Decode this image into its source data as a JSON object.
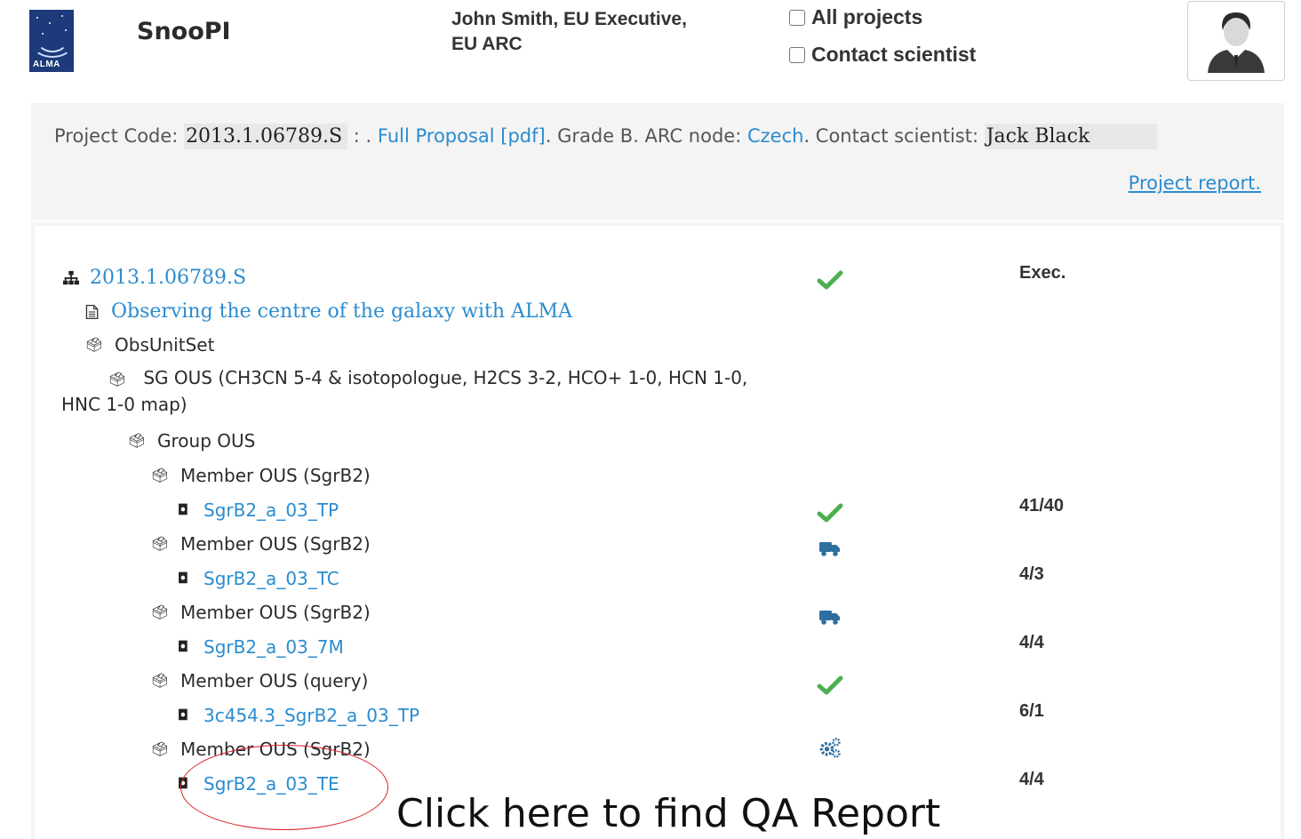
{
  "header": {
    "app_title": "SnooPI",
    "logo_text": "ALMA",
    "user_line1": "John Smith, EU Executive,",
    "user_line2": "EU ARC",
    "all_projects_label": "All projects",
    "contact_scientist_label": "Contact scientist"
  },
  "info": {
    "project_code_label": "Project Code:",
    "project_code": "2013.1.06789.S",
    "dot_sep": " : .",
    "full_proposal": "Full Proposal [pdf]",
    "grade_text": ". Grade B. ARC node:",
    "arc_node": "Czech",
    "contact_label": ". Contact scientist:",
    "contact_name": "Jack Black",
    "project_report": "Project report."
  },
  "tree": {
    "root": "2013.1.06789.S",
    "title": "Observing the centre of the galaxy with ALMA",
    "obs_unit_set": "ObsUnitSet",
    "sg_ous": "SG OUS (CH3CN 5-4 & isotopologue, H2CS 3-2, HCO+ 1-0, HCN 1-0, HNC 1-0 map)",
    "group_ous": "Group OUS",
    "root_status_text": "Exec.",
    "members": [
      {
        "member_label": "Member OUS (SgrB2)",
        "sb": "SgrB2_a_03_TP",
        "status": "check",
        "count": "41/40"
      },
      {
        "member_label": "Member OUS (SgrB2)",
        "sb": "SgrB2_a_03_TC",
        "status": "truck",
        "count": "4/3"
      },
      {
        "member_label": "Member OUS (SgrB2)",
        "sb": "SgrB2_a_03_7M",
        "status": "truck",
        "count": "4/4"
      },
      {
        "member_label": "Member OUS (query)",
        "sb": "3c454.3_SgrB2_a_03_TP",
        "status": "check",
        "count": "6/1"
      },
      {
        "member_label": "Member OUS (SgrB2)",
        "sb": "SgrB2_a_03_TE",
        "status": "gears",
        "count": "4/4"
      }
    ]
  },
  "annotation": {
    "callout": "Click here to find QA Report"
  },
  "colors": {
    "link": "#2a8ccf",
    "check": "#4caf50",
    "icon_blue": "#2f6f9f",
    "annotation_red": "#d81f26"
  }
}
